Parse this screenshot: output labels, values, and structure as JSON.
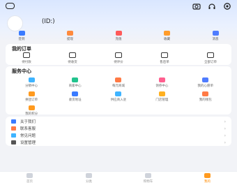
{
  "profile": {
    "id_label": "(ID:)"
  },
  "top_icons": [
    "camera-icon",
    "headset-icon",
    "settings-icon"
  ],
  "quick_actions": [
    {
      "label": "签到",
      "icon": "calendar-icon",
      "color": "#3a7bff"
    },
    {
      "label": "提现",
      "icon": "wallet-icon",
      "color": "#ff8a3d"
    },
    {
      "label": "充值",
      "icon": "recharge-icon",
      "color": "#ff5a5a"
    },
    {
      "label": "收藏",
      "icon": "star-icon",
      "color": "#ff9c2a"
    },
    {
      "label": "消息",
      "icon": "message-icon",
      "color": "#4f7cff"
    }
  ],
  "orders": {
    "title": "我的订单",
    "items": [
      {
        "label": "待付款",
        "icon": "wallet-outline-icon"
      },
      {
        "label": "待收货",
        "icon": "truck-icon"
      },
      {
        "label": "待评价",
        "icon": "comment-icon"
      },
      {
        "label": "售后单",
        "icon": "aftersale-icon"
      },
      {
        "label": "全部订单",
        "icon": "order-list-icon"
      }
    ]
  },
  "services": {
    "title": "服务中心",
    "items": [
      {
        "label": "分销中心",
        "icon": "distribution-icon",
        "color": "#3fb4ff"
      },
      {
        "label": "商家中心",
        "icon": "store-icon",
        "color": "#22c38e"
      },
      {
        "label": "每元商城",
        "icon": "mall-icon",
        "color": "#ff7a45"
      },
      {
        "label": "领券中心",
        "icon": "coupon-icon",
        "color": "#ff5f8f"
      },
      {
        "label": "我的心愿单",
        "icon": "wishlist-icon",
        "color": "#4f7cff"
      },
      {
        "label": "拼团订单",
        "icon": "group-buy-icon",
        "color": "#ff9a1f"
      },
      {
        "label": "收货地址",
        "icon": "address-icon",
        "color": "#3a7bff"
      },
      {
        "label": "供应商入驻",
        "icon": "supplier-icon",
        "color": "#3fb4ff"
      },
      {
        "label": "门店管理",
        "icon": "shop-manage-icon",
        "color": "#ffb020"
      },
      {
        "label": "我的钱包",
        "icon": "wallet-icon",
        "color": "#ff7a45"
      },
      {
        "label": "我的积分",
        "icon": "points-icon",
        "color": "#ff9a1f"
      }
    ]
  },
  "settings": [
    {
      "label": "关于我们",
      "icon": "info-icon",
      "color": "#3a7bff"
    },
    {
      "label": "联系客服",
      "icon": "service-icon",
      "color": "#ff7a45"
    },
    {
      "label": "常见问题",
      "icon": "faq-icon",
      "color": "#3fb4ff"
    },
    {
      "label": "设置管理",
      "icon": "settings-manage-icon",
      "color": "#555555"
    }
  ],
  "tabbar": [
    {
      "label": "首页",
      "icon": "home-icon",
      "active": false
    },
    {
      "label": "分类",
      "icon": "category-icon",
      "active": false
    },
    {
      "label": "购物车",
      "icon": "cart-icon",
      "active": false
    },
    {
      "label": "我的",
      "icon": "user-icon",
      "active": true
    }
  ]
}
